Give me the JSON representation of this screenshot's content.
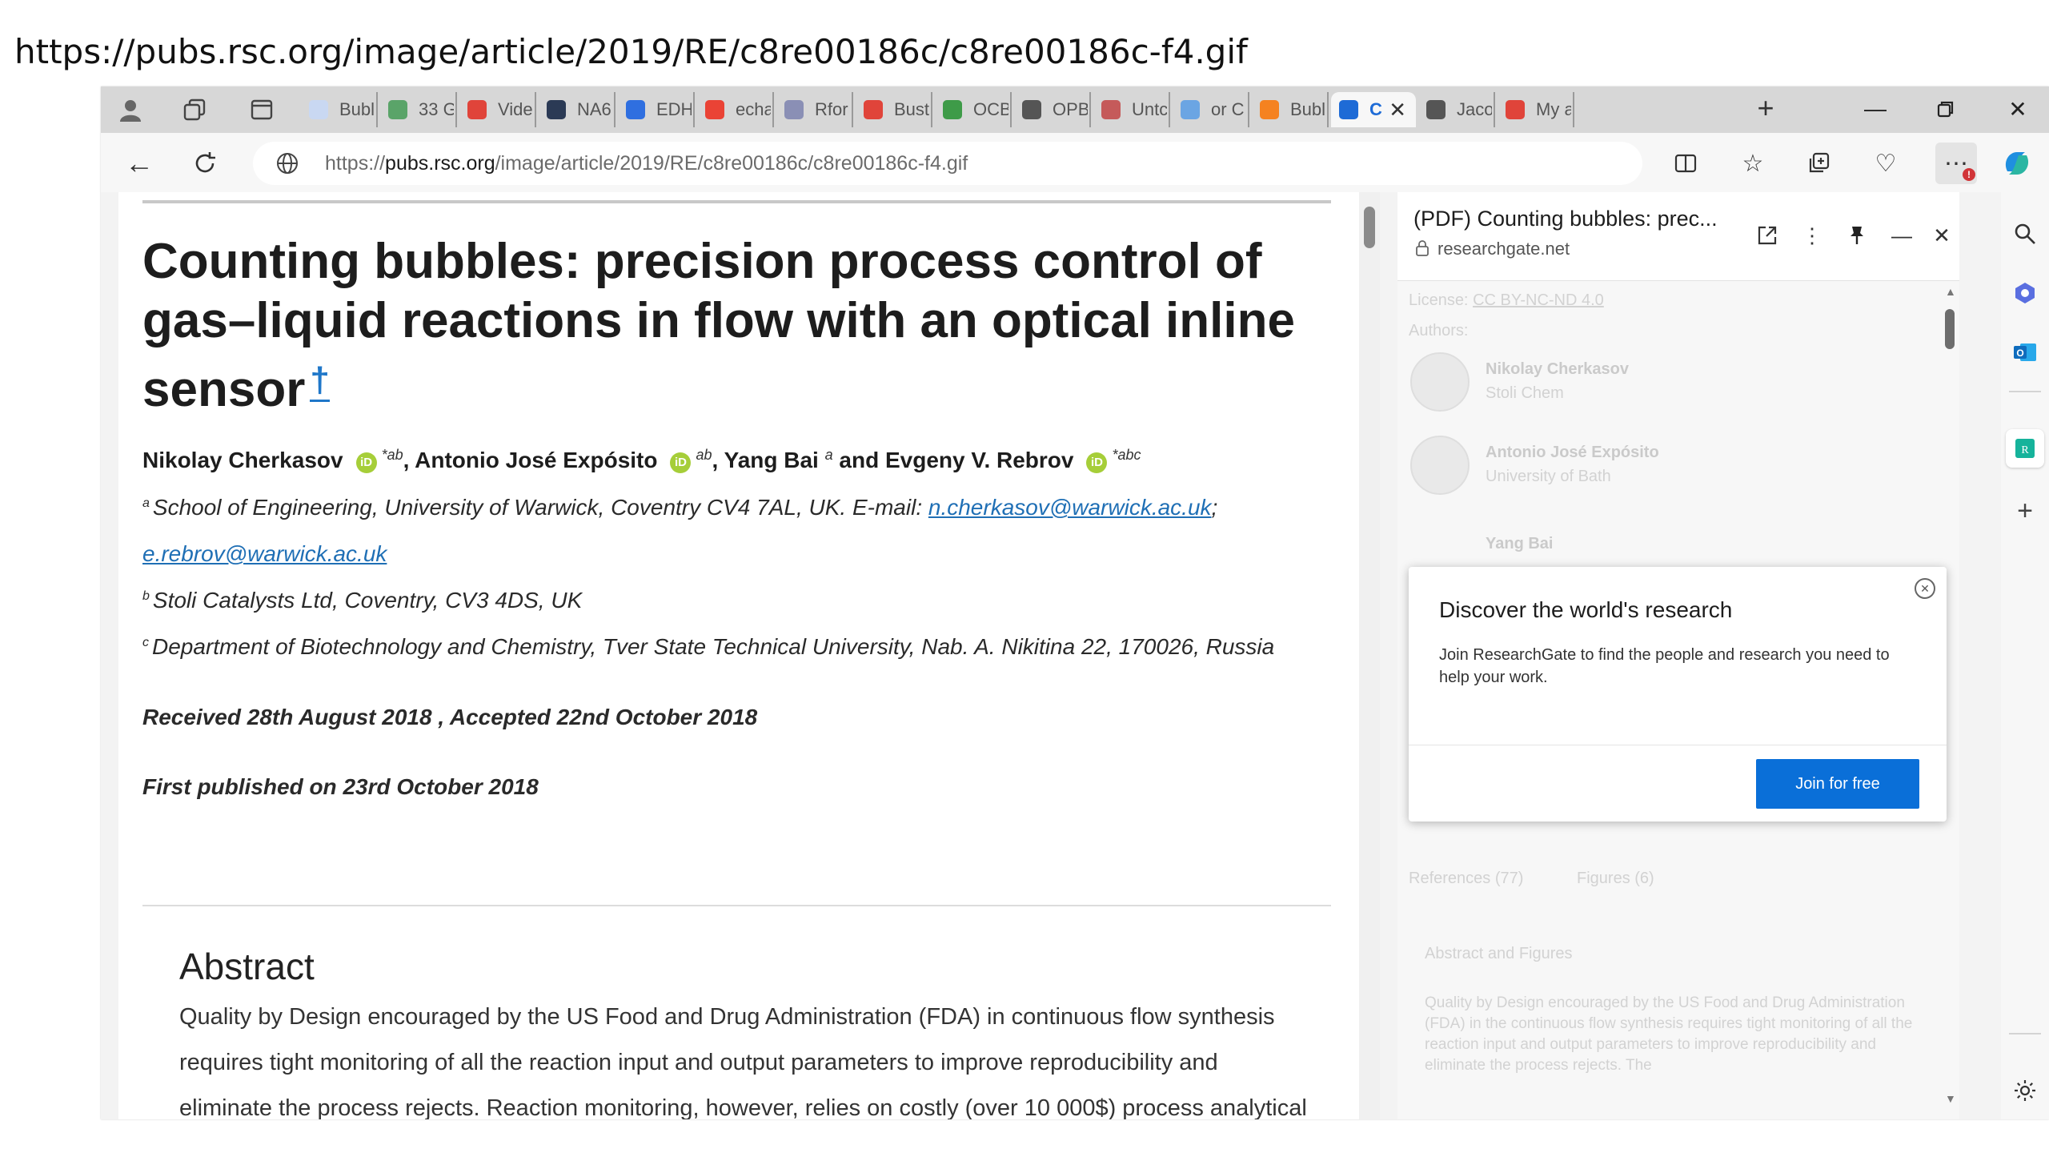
{
  "slide_url": "https://pubs.rsc.org/image/article/2019/RE/c8re00186c/c8re00186c-f4.gif",
  "tabs": [
    {
      "label": "Bubl",
      "color": "#c9d8f2"
    },
    {
      "label": "33 G",
      "color": "#5aa469"
    },
    {
      "label": "Vide",
      "color": "#e0443a"
    },
    {
      "label": "NA6",
      "color": "#2b3a55"
    },
    {
      "label": "EDH",
      "color": "#2f6fe0"
    },
    {
      "label": "echa",
      "color": "#ea4335"
    },
    {
      "label": "Rfor",
      "color": "#8a8fb5"
    },
    {
      "label": "Bust",
      "color": "#e0443a"
    },
    {
      "label": "OCB",
      "color": "#3e9b48"
    },
    {
      "label": "OPB",
      "color": "#555555"
    },
    {
      "label": "Untc",
      "color": "#c55a5a"
    },
    {
      "label": "or C",
      "color": "#6ba5e3"
    },
    {
      "label": "Bubl",
      "color": "#f58220"
    }
  ],
  "active_tab": {
    "label": "C",
    "color": "#1e6bd6"
  },
  "tabs_after": [
    {
      "label": "Jaco",
      "color": "#555555"
    },
    {
      "label": "My a",
      "color": "#e0443a"
    }
  ],
  "address": {
    "prefix": "https://",
    "domain": "pubs.rsc.org",
    "path": "/image/article/2019/RE/c8re00186c/c8re00186c-f4.gif"
  },
  "article": {
    "title": "Counting bubbles: precision process control of gas–liquid reactions in flow with an optical inline sensor",
    "dagger": "†",
    "authors": [
      {
        "name": "Nikolay Cherkasov",
        "sup": "*ab"
      },
      {
        "name": ", Antonio José Expósito",
        "sup": "ab"
      },
      {
        "name": ", Yang Bai ",
        "sup": "a"
      },
      {
        "name": " and Evgeny V. Rebrov",
        "sup": "*abc"
      }
    ],
    "affil_a_text": "School of Engineering, University of Warwick, Coventry CV4 7AL, UK. E-mail:",
    "affil_a_email1": "n.cherkasov@warwick.ac.uk",
    "affil_a_sep": ";",
    "affil_a_email2": "e.rebrov@warwick.ac.uk",
    "affil_b": "Stoli Catalysts Ltd, Coventry, CV3 4DS, UK",
    "affil_c": "Department of Biotechnology and Chemistry, Tver State Technical University, Nab. A. Nikitina 22, 170026, Russia",
    "received": "Received 28th August 2018 , Accepted 22nd October 2018",
    "published": "First published on 23rd October 2018",
    "abstract_heading": "Abstract",
    "abstract_text": "Quality by Design encouraged by the US Food and Drug Administration (FDA) in continuous flow synthesis requires tight monitoring of all the reaction input and output parameters to improve reproducibility and eliminate the process rejects. Reaction monitoring, however, relies on costly (over 10 000$) process analytical"
  },
  "side_pane": {
    "title": "(PDF) Counting bubbles: prec...",
    "site": "researchgate.net",
    "faded": {
      "license": "License:",
      "license_val": "CC BY-NC-ND 4.0",
      "authors": "Authors:",
      "a1": "Nikolay Cherkasov",
      "a1_sub": "Stoli Chem",
      "a2": "Antonio José Expósito",
      "a2_sub": "University of Bath",
      "a3": "Yang Bai",
      "refs": "References (77)",
      "figs": "Figures (6)",
      "abs": "Abstract and Figures",
      "abs_text": "Quality by Design encouraged by the US Food and Drug Administration (FDA) in the continuous flow synthesis requires tight monitoring of all the reaction input and output parameters to improve reproducibility and eliminate the process rejects. The"
    },
    "popup": {
      "heading": "Discover the world's research",
      "body": "Join ResearchGate to find the people and research you need to help your work.",
      "button": "Join for free"
    }
  },
  "colors": {
    "accent": "#0a6fd8",
    "link": "#1f6fb5",
    "orcid": "#a6ce39"
  }
}
